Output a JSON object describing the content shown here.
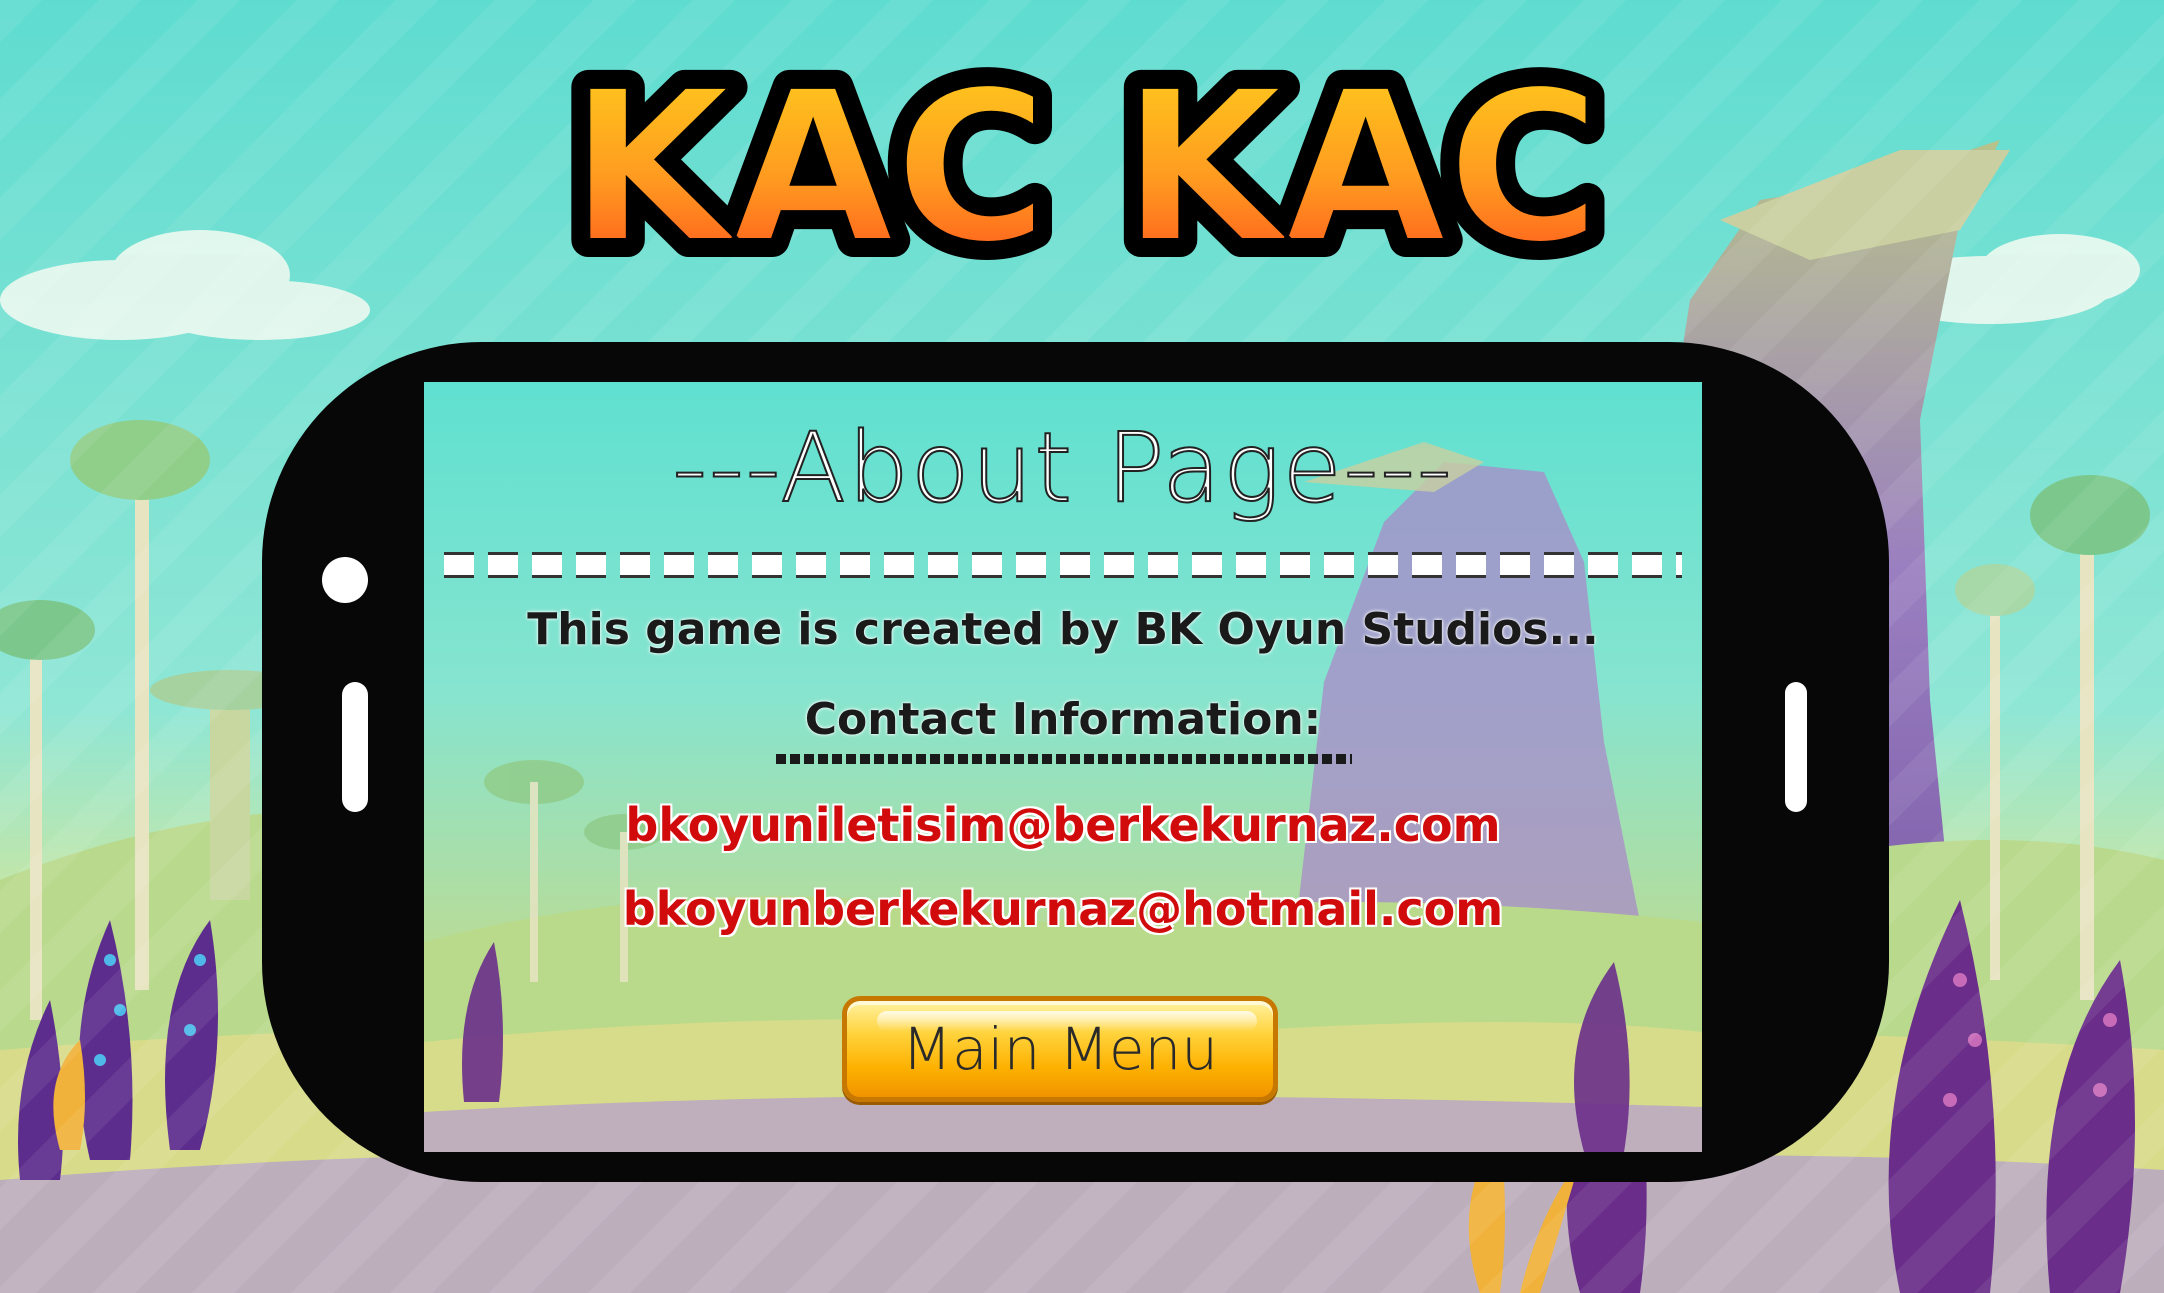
{
  "game": {
    "logo_text": "KAC KAC"
  },
  "about": {
    "title": "---About Page---",
    "credit": "This game is created by BK Oyun Studios...",
    "contact_heading": "Contact Information:",
    "emails": [
      "bkoyuniletisim@berkekurnaz.com",
      "bkoyunberkekurnaz@hotmail.com"
    ]
  },
  "buttons": {
    "main_menu": "Main Menu"
  },
  "colors": {
    "logo_fill_top": "#ffd21c",
    "logo_fill_bottom": "#ff4a1c",
    "email_text": "#d10b0b",
    "button_fill": "#ffc61a",
    "phone_body": "#070707"
  }
}
